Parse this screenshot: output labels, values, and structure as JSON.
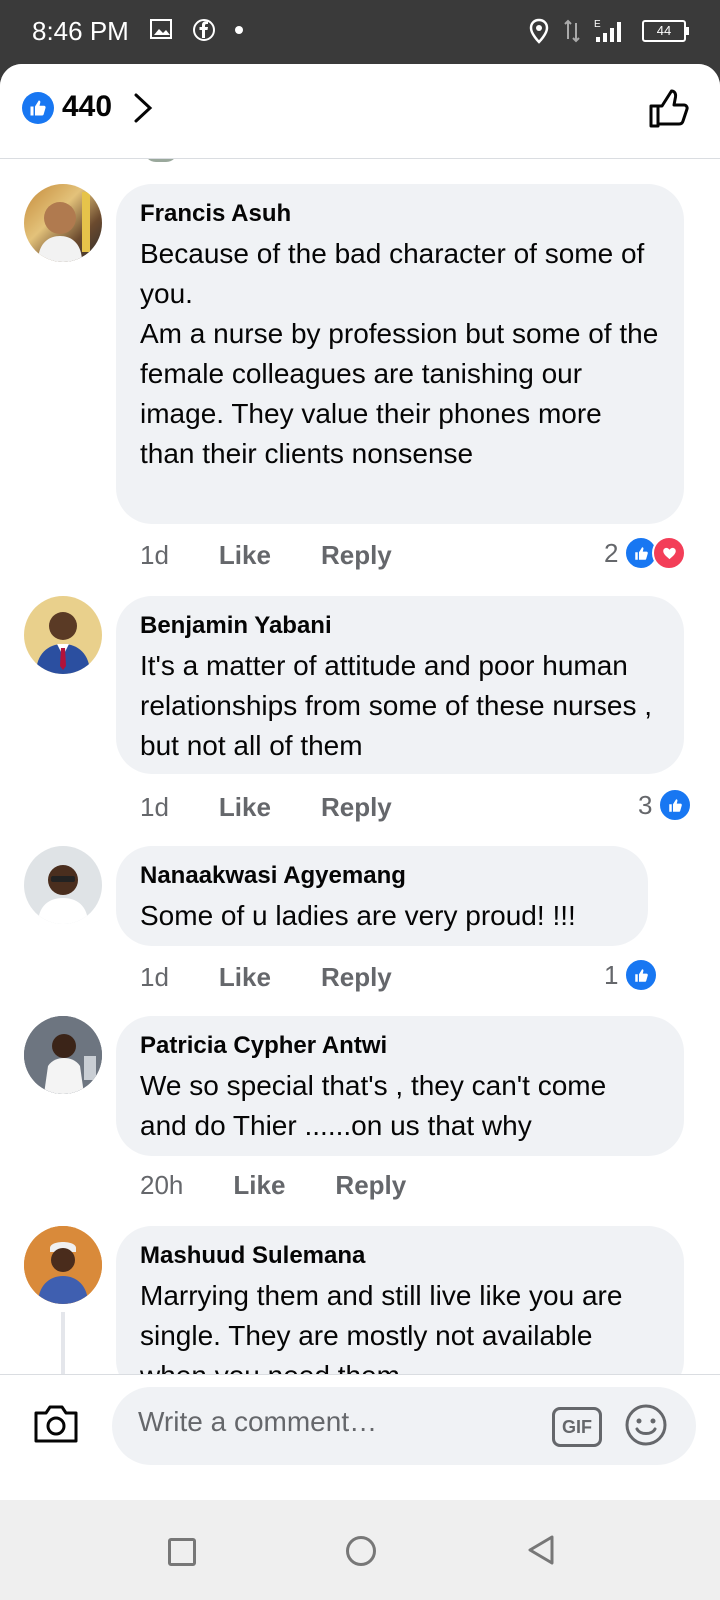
{
  "status_bar": {
    "time": "8:46 PM",
    "network": "E",
    "battery": "44"
  },
  "header": {
    "reaction_count": "440"
  },
  "comments": [
    {
      "name": "Francis Asuh",
      "text": "Because of the bad character of some of you.\nAm a nurse by profession but some of the female colleagues are tanishing our image. They value their phones more than their clients nonsense",
      "time": "1d",
      "like": "Like",
      "reply": "Reply",
      "reaction_count": "2",
      "reactions": [
        "like",
        "love"
      ]
    },
    {
      "name": "Benjamin Yabani",
      "text": "It's a matter of attitude and poor human relationships from some of these nurses , but not all of them",
      "time": "1d",
      "like": "Like",
      "reply": "Reply",
      "reaction_count": "3",
      "reactions": [
        "like"
      ]
    },
    {
      "name": "Nanaakwasi Agyemang",
      "text": "Some of u ladies are very proud! !!!",
      "time": "1d",
      "like": "Like",
      "reply": "Reply",
      "reaction_count": "1",
      "reactions": [
        "like"
      ]
    },
    {
      "name": "Patricia Cypher Antwi",
      "text": "We so special that's , they can't come and do Thier ......on us that why",
      "time": "20h",
      "like": "Like",
      "reply": "Reply"
    },
    {
      "name": "Mashuud Sulemana",
      "text": "Marrying them and still live like you are single. They are mostly not available when you need them"
    }
  ],
  "composer": {
    "placeholder": "Write a comment…",
    "gif_label": "GIF"
  },
  "colors": {
    "facebook_blue": "#1877f2",
    "love_red": "#f33e58",
    "bubble_gray": "#f0f2f5",
    "meta_gray": "#65676b"
  },
  "icons": [
    "like-reaction-icon",
    "chevron-right-icon",
    "thumbs-up-outline-icon",
    "love-reaction-icon",
    "camera-icon",
    "gif-icon",
    "emoji-icon",
    "recents-icon",
    "home-icon",
    "back-icon"
  ]
}
